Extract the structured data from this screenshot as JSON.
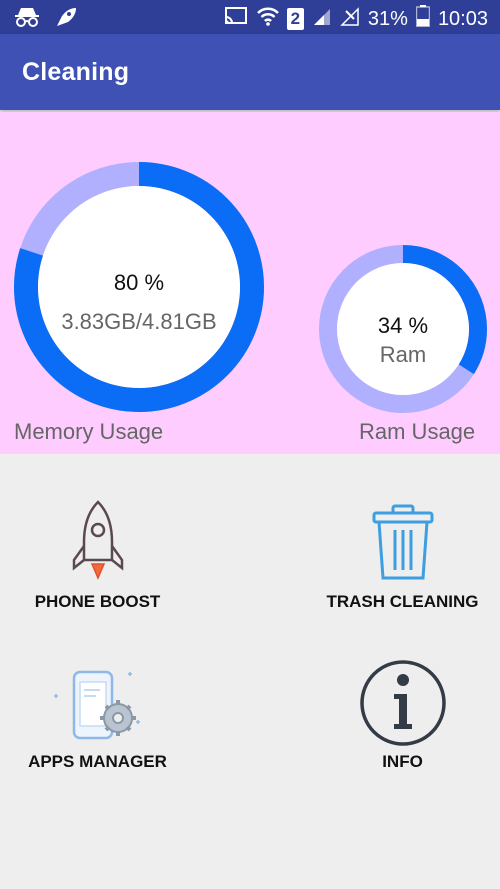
{
  "status_bar": {
    "battery_text": "31%",
    "clock": "10:03",
    "sim_badge": "2",
    "icons": [
      "incognito-icon",
      "rocket-notification-icon",
      "cast-icon",
      "wifi-icon",
      "sim-2-icon",
      "signal-icon",
      "no-signal-icon",
      "battery-icon"
    ]
  },
  "app_bar": {
    "title": "Cleaning"
  },
  "memory": {
    "percent_text": "80 %",
    "size_text": "3.83GB/4.81GB",
    "label": "Memory Usage",
    "fraction": 0.8
  },
  "ram": {
    "percent_text": "34 %",
    "name": "Ram",
    "label": "Ram Usage",
    "fraction": 0.34
  },
  "tiles": {
    "phone_boost": {
      "label": "PHONE BOOST",
      "icon": "rocket-icon"
    },
    "trash_cleaning": {
      "label": "TRASH CLEANING",
      "icon": "trash-icon"
    },
    "apps_manager": {
      "label": "APPS MANAGER",
      "icon": "phone-gear-icon"
    },
    "info": {
      "label": "INFO",
      "icon": "info-icon"
    }
  },
  "colors": {
    "status_bar": "#2f3f98",
    "app_bar": "#3f51b5",
    "usage_panel": "#ffccff",
    "gauge_fill": "#0b6cf5",
    "gauge_track": "#b0b0ff",
    "content_bg": "#eeeeee"
  }
}
